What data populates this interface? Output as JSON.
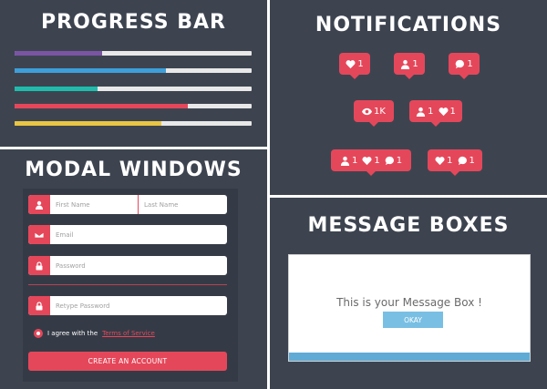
{
  "progress": {
    "title": "PROGRESS BAR",
    "bars": [
      {
        "color": "#7b55a3",
        "percent": 37
      },
      {
        "color": "#3d9fd9",
        "percent": 64
      },
      {
        "color": "#1fbcac",
        "percent": 35
      },
      {
        "color": "#e5475a",
        "percent": 73
      },
      {
        "color": "#e9c543",
        "percent": 62
      }
    ],
    "track_color": "#e8e8e8"
  },
  "notifications": {
    "title": "NOTIFICATIONS",
    "badge_color": "#e5475a",
    "badges": [
      {
        "items": [
          {
            "icon": "heart-icon",
            "count": "1"
          }
        ]
      },
      {
        "items": [
          {
            "icon": "user-icon",
            "count": "1"
          }
        ]
      },
      {
        "items": [
          {
            "icon": "comment-icon",
            "count": "1"
          }
        ]
      },
      {
        "items": [
          {
            "icon": "eye-icon",
            "count": "1K"
          }
        ]
      },
      {
        "items": [
          {
            "icon": "user-icon",
            "count": "1"
          },
          {
            "icon": "heart-icon",
            "count": "1"
          }
        ]
      },
      {
        "items": [
          {
            "icon": "user-icon",
            "count": "1"
          },
          {
            "icon": "heart-icon",
            "count": "1"
          },
          {
            "icon": "comment-icon",
            "count": "1"
          }
        ]
      },
      {
        "items": [
          {
            "icon": "heart-icon",
            "count": "1"
          },
          {
            "icon": "comment-icon",
            "count": "1"
          }
        ]
      }
    ]
  },
  "modal": {
    "title": "MODAL WINDOWS",
    "first_name_placeholder": "First Name",
    "last_name_placeholder": "Last Name",
    "email_placeholder": "Email",
    "password_placeholder": "Password",
    "retype_placeholder": "Retype Password",
    "agree_text": "I agree with the",
    "tos_link": "Terms of Service",
    "create_button": "CREATE AN ACCOUNT",
    "accent_color": "#e5475a"
  },
  "message": {
    "title": "MESSAGE BOXES",
    "text": "This is your Message Box !",
    "okay_button": "OKAY",
    "button_color": "#79bfe3",
    "footer_color": "#5fabd6"
  }
}
